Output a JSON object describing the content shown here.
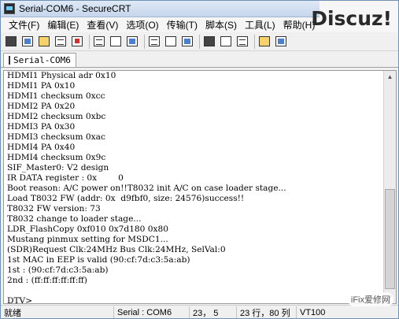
{
  "window": {
    "title": "Serial-COM6 - SecureCRT",
    "watermark": "Discuz!",
    "watermark_bottom": "iFix爱修网"
  },
  "menu": [
    "文件(F)",
    "编辑(E)",
    "查看(V)",
    "选项(O)",
    "传输(T)",
    "脚本(S)",
    "工具(L)",
    "帮助(H)"
  ],
  "toolbar": {
    "icons": [
      "connect-icon",
      "quick-connect-icon",
      "connect-tab-icon",
      "reconnect-icon",
      "disconnect-icon",
      "copy-icon",
      "paste-icon",
      "find-icon",
      "print-icon",
      "print-setup-icon",
      "sftp-icon",
      "session-options-icon",
      "global-options-icon",
      "keymap-icon",
      "help-icon",
      "about-icon"
    ]
  },
  "tab": {
    "label": "Serial-COM6"
  },
  "terminal": {
    "lines": [
      "HDMI1 Physical adr 0x10",
      "HDMI1 PA 0x10",
      "HDMI1 checksum 0xcc",
      "HDMI2 PA 0x20",
      "HDMI2 checksum 0xbc",
      "HDMI3 PA 0x30",
      "HDMI3 checksum 0xac",
      "HDMI4 PA 0x40",
      "HDMI4 checksum 0x9c",
      "SIF_Master0: V2 design",
      "IR DATA register : 0x        0",
      "Boot reason: A/C power on!!T8032 init A/C on case loader stage...",
      "Load T8032 FW (addr: 0x  d9fbf0, size: 24576)success!!",
      "T8032 FW version: 73",
      "T8032 change to loader stage...",
      "LDR_FlashCopy 0xf010 0x7d180 0x80",
      "Mustang pinmux setting for MSDC1...",
      "(SDR)Request Clk:24MHz Bus Clk:24MHz, SelVal:0",
      "1st MAC in EEP is valid (90:cf:7d:c3:5a:ab)",
      "1st : (90:cf:7d:c3:5a:ab)",
      "2nd : (ff:ff:ff:ff:ff:ff)",
      "",
      "DTV>"
    ]
  },
  "status": {
    "ready": "就绪",
    "session": "Serial : COM6",
    "cursor": "23，  5",
    "size": "23 行，80 列",
    "emulation": "VT100"
  }
}
